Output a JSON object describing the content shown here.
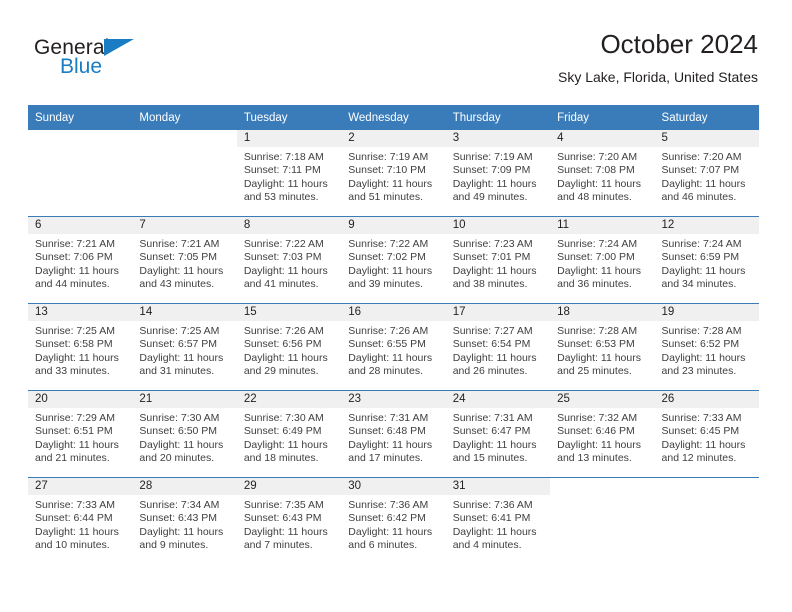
{
  "brand": {
    "name_part1": "General",
    "name_part2": "Blue",
    "logo_icon": "triangle-flag-icon",
    "accent_color": "#1a7dc4"
  },
  "header": {
    "title": "October 2024",
    "subtitle": "Sky Lake, Florida, United States"
  },
  "calendar": {
    "header_color": "#3a7cba",
    "weekday_headers": [
      "Sunday",
      "Monday",
      "Tuesday",
      "Wednesday",
      "Thursday",
      "Friday",
      "Saturday"
    ],
    "weeks": [
      [
        {
          "day": "",
          "blank": true
        },
        {
          "day": "",
          "blank": true
        },
        {
          "day": "1",
          "sunrise": "Sunrise: 7:18 AM",
          "sunset": "Sunset: 7:11 PM",
          "daylight": "Daylight: 11 hours and 53 minutes."
        },
        {
          "day": "2",
          "sunrise": "Sunrise: 7:19 AM",
          "sunset": "Sunset: 7:10 PM",
          "daylight": "Daylight: 11 hours and 51 minutes."
        },
        {
          "day": "3",
          "sunrise": "Sunrise: 7:19 AM",
          "sunset": "Sunset: 7:09 PM",
          "daylight": "Daylight: 11 hours and 49 minutes."
        },
        {
          "day": "4",
          "sunrise": "Sunrise: 7:20 AM",
          "sunset": "Sunset: 7:08 PM",
          "daylight": "Daylight: 11 hours and 48 minutes."
        },
        {
          "day": "5",
          "sunrise": "Sunrise: 7:20 AM",
          "sunset": "Sunset: 7:07 PM",
          "daylight": "Daylight: 11 hours and 46 minutes."
        }
      ],
      [
        {
          "day": "6",
          "sunrise": "Sunrise: 7:21 AM",
          "sunset": "Sunset: 7:06 PM",
          "daylight": "Daylight: 11 hours and 44 minutes."
        },
        {
          "day": "7",
          "sunrise": "Sunrise: 7:21 AM",
          "sunset": "Sunset: 7:05 PM",
          "daylight": "Daylight: 11 hours and 43 minutes."
        },
        {
          "day": "8",
          "sunrise": "Sunrise: 7:22 AM",
          "sunset": "Sunset: 7:03 PM",
          "daylight": "Daylight: 11 hours and 41 minutes."
        },
        {
          "day": "9",
          "sunrise": "Sunrise: 7:22 AM",
          "sunset": "Sunset: 7:02 PM",
          "daylight": "Daylight: 11 hours and 39 minutes."
        },
        {
          "day": "10",
          "sunrise": "Sunrise: 7:23 AM",
          "sunset": "Sunset: 7:01 PM",
          "daylight": "Daylight: 11 hours and 38 minutes."
        },
        {
          "day": "11",
          "sunrise": "Sunrise: 7:24 AM",
          "sunset": "Sunset: 7:00 PM",
          "daylight": "Daylight: 11 hours and 36 minutes."
        },
        {
          "day": "12",
          "sunrise": "Sunrise: 7:24 AM",
          "sunset": "Sunset: 6:59 PM",
          "daylight": "Daylight: 11 hours and 34 minutes."
        }
      ],
      [
        {
          "day": "13",
          "sunrise": "Sunrise: 7:25 AM",
          "sunset": "Sunset: 6:58 PM",
          "daylight": "Daylight: 11 hours and 33 minutes."
        },
        {
          "day": "14",
          "sunrise": "Sunrise: 7:25 AM",
          "sunset": "Sunset: 6:57 PM",
          "daylight": "Daylight: 11 hours and 31 minutes."
        },
        {
          "day": "15",
          "sunrise": "Sunrise: 7:26 AM",
          "sunset": "Sunset: 6:56 PM",
          "daylight": "Daylight: 11 hours and 29 minutes."
        },
        {
          "day": "16",
          "sunrise": "Sunrise: 7:26 AM",
          "sunset": "Sunset: 6:55 PM",
          "daylight": "Daylight: 11 hours and 28 minutes."
        },
        {
          "day": "17",
          "sunrise": "Sunrise: 7:27 AM",
          "sunset": "Sunset: 6:54 PM",
          "daylight": "Daylight: 11 hours and 26 minutes."
        },
        {
          "day": "18",
          "sunrise": "Sunrise: 7:28 AM",
          "sunset": "Sunset: 6:53 PM",
          "daylight": "Daylight: 11 hours and 25 minutes."
        },
        {
          "day": "19",
          "sunrise": "Sunrise: 7:28 AM",
          "sunset": "Sunset: 6:52 PM",
          "daylight": "Daylight: 11 hours and 23 minutes."
        }
      ],
      [
        {
          "day": "20",
          "sunrise": "Sunrise: 7:29 AM",
          "sunset": "Sunset: 6:51 PM",
          "daylight": "Daylight: 11 hours and 21 minutes."
        },
        {
          "day": "21",
          "sunrise": "Sunrise: 7:30 AM",
          "sunset": "Sunset: 6:50 PM",
          "daylight": "Daylight: 11 hours and 20 minutes."
        },
        {
          "day": "22",
          "sunrise": "Sunrise: 7:30 AM",
          "sunset": "Sunset: 6:49 PM",
          "daylight": "Daylight: 11 hours and 18 minutes."
        },
        {
          "day": "23",
          "sunrise": "Sunrise: 7:31 AM",
          "sunset": "Sunset: 6:48 PM",
          "daylight": "Daylight: 11 hours and 17 minutes."
        },
        {
          "day": "24",
          "sunrise": "Sunrise: 7:31 AM",
          "sunset": "Sunset: 6:47 PM",
          "daylight": "Daylight: 11 hours and 15 minutes."
        },
        {
          "day": "25",
          "sunrise": "Sunrise: 7:32 AM",
          "sunset": "Sunset: 6:46 PM",
          "daylight": "Daylight: 11 hours and 13 minutes."
        },
        {
          "day": "26",
          "sunrise": "Sunrise: 7:33 AM",
          "sunset": "Sunset: 6:45 PM",
          "daylight": "Daylight: 11 hours and 12 minutes."
        }
      ],
      [
        {
          "day": "27",
          "sunrise": "Sunrise: 7:33 AM",
          "sunset": "Sunset: 6:44 PM",
          "daylight": "Daylight: 11 hours and 10 minutes."
        },
        {
          "day": "28",
          "sunrise": "Sunrise: 7:34 AM",
          "sunset": "Sunset: 6:43 PM",
          "daylight": "Daylight: 11 hours and 9 minutes."
        },
        {
          "day": "29",
          "sunrise": "Sunrise: 7:35 AM",
          "sunset": "Sunset: 6:43 PM",
          "daylight": "Daylight: 11 hours and 7 minutes."
        },
        {
          "day": "30",
          "sunrise": "Sunrise: 7:36 AM",
          "sunset": "Sunset: 6:42 PM",
          "daylight": "Daylight: 11 hours and 6 minutes."
        },
        {
          "day": "31",
          "sunrise": "Sunrise: 7:36 AM",
          "sunset": "Sunset: 6:41 PM",
          "daylight": "Daylight: 11 hours and 4 minutes."
        },
        {
          "day": "",
          "blank": true
        },
        {
          "day": "",
          "blank": true
        }
      ]
    ]
  }
}
